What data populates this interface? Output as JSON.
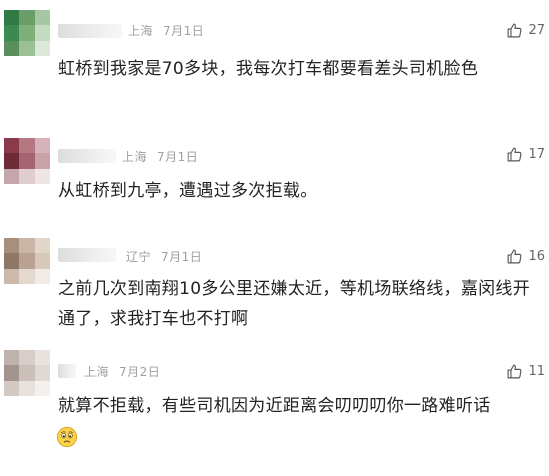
{
  "comments": [
    {
      "location": "上海",
      "date": "7月1日",
      "likes": "27",
      "text": "虹桥到我家是70多块，我每次打车都要看差头司机脸色",
      "avatar_colors": [
        "#2f7a45",
        "#6a9e68",
        "#a7c7a4",
        "#3b8a51",
        "#7fae78",
        "#c3dbc0",
        "#5a8f5c",
        "#9cc095",
        "#dce9d9"
      ]
    },
    {
      "location": "上海",
      "date": "7月1日",
      "likes": "17",
      "text": "从虹桥到九亭，遭遇过多次拒载。",
      "avatar_colors": [
        "#8a3a4a",
        "#b57883",
        "#d6b3ba",
        "#6e2a38",
        "#a56472",
        "#caa0a9",
        "#c4a6ab",
        "#e0cdd0",
        "#efe4e6"
      ]
    },
    {
      "location": "辽宁",
      "date": "7月1日",
      "likes": "16",
      "text": "之前几次到南翔10多公里还嫌太近，等机场联络线，嘉闵线开通了，求我打车也不打啊",
      "avatar_colors": [
        "#a88f7c",
        "#c9b6a6",
        "#e2d6cb",
        "#8f7766",
        "#b9a291",
        "#d7c8bb",
        "#cbb9ab",
        "#e4d9cf",
        "#f1ebe6"
      ]
    },
    {
      "location": "上海",
      "date": "7月2日",
      "likes": "11",
      "text": "就算不拒载，有些司机因为近距离会叨叨叨你一路难听话",
      "emoji": "worried-face-emoji",
      "avatar_colors": [
        "#bfb3ad",
        "#d8cec9",
        "#e9e3e0",
        "#a3958e",
        "#cbbfb9",
        "#e0d8d4",
        "#d3c9c4",
        "#e8e2df",
        "#f4f0ee"
      ]
    }
  ],
  "icons": {
    "like": "thumbs-up-icon"
  },
  "colors": {
    "meta_text": "#a0a0a0",
    "body_text": "#222222",
    "like_count": "#666666"
  }
}
